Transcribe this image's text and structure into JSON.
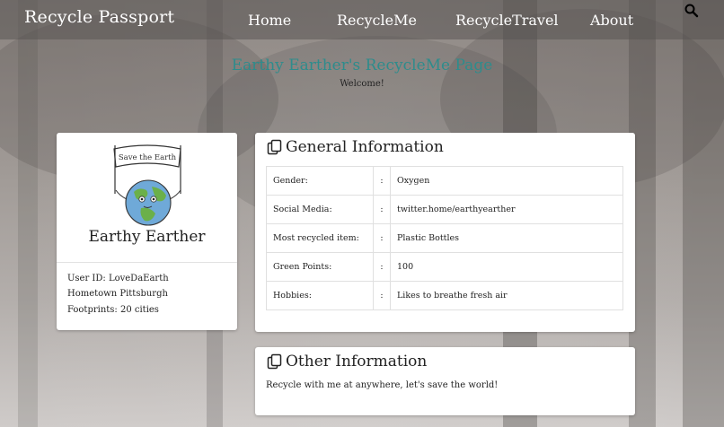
{
  "navbar": {
    "brand": "Recycle Passport",
    "links": [
      "Home",
      "RecycleMe",
      "RecycleTravel",
      "About"
    ]
  },
  "page": {
    "title": "Earthy Earther's RecycleMe Page",
    "welcome": "Welcome!"
  },
  "profile": {
    "logo_banner_text": "Save the Earth",
    "name": "Earthy Earther",
    "user_id": "User ID: LoveDaEarth",
    "hometown": "Hometown Pittsburgh",
    "footprints": "Footprints: 20 cities"
  },
  "general_info": {
    "heading": "General Information",
    "rows": [
      {
        "label": "Gender:",
        "sep": ":",
        "value": "Oxygen"
      },
      {
        "label": "Social Media:",
        "sep": ":",
        "value": "twitter.home/earthyearther"
      },
      {
        "label": "Most recycled item:",
        "sep": ":",
        "value": "Plastic Bottles"
      },
      {
        "label": "Green Points:",
        "sep": ":",
        "value": "100"
      },
      {
        "label": "Hobbies:",
        "sep": ":",
        "value": "Likes to breathe fresh air"
      }
    ]
  },
  "other_info": {
    "heading": "Other Information",
    "text": "Recycle with me at anywhere, let's save the world!"
  },
  "colors": {
    "title_teal": "#2e8c8c",
    "earth_blue": "#6fa9d8",
    "earth_green": "#6bb04a"
  },
  "icons": {
    "search": "search-icon",
    "copy": "copy-icon",
    "logo": "earth-logo"
  }
}
